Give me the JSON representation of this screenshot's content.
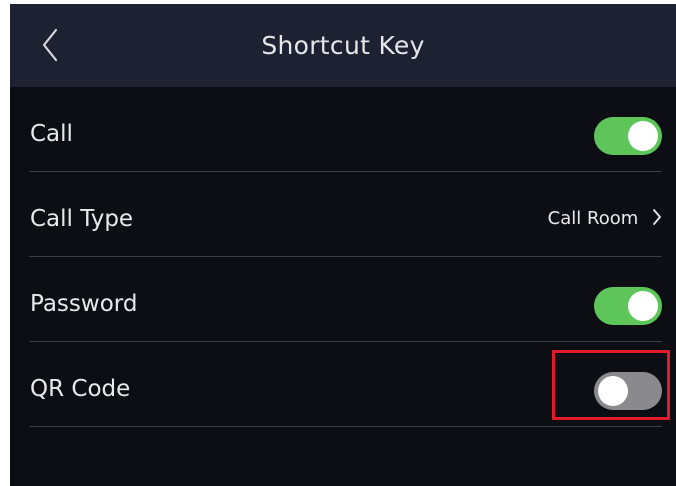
{
  "header": {
    "title": "Shortcut Key",
    "back_icon": "chevron-left-icon"
  },
  "settings": [
    {
      "label": "Call",
      "control": "toggle",
      "state": "on"
    },
    {
      "label": "Call Type",
      "control": "link",
      "value": "Call Room",
      "icon": "chevron-right-icon"
    },
    {
      "label": "Password",
      "control": "toggle",
      "state": "on"
    },
    {
      "label": "QR Code",
      "control": "toggle",
      "state": "off"
    }
  ],
  "colors": {
    "header_bg": "#1e2131",
    "screen_bg": "#0d0e14",
    "toggle_on": "#5ec55a",
    "toggle_off": "#8a8a8e",
    "highlight": "#e01b2a"
  }
}
